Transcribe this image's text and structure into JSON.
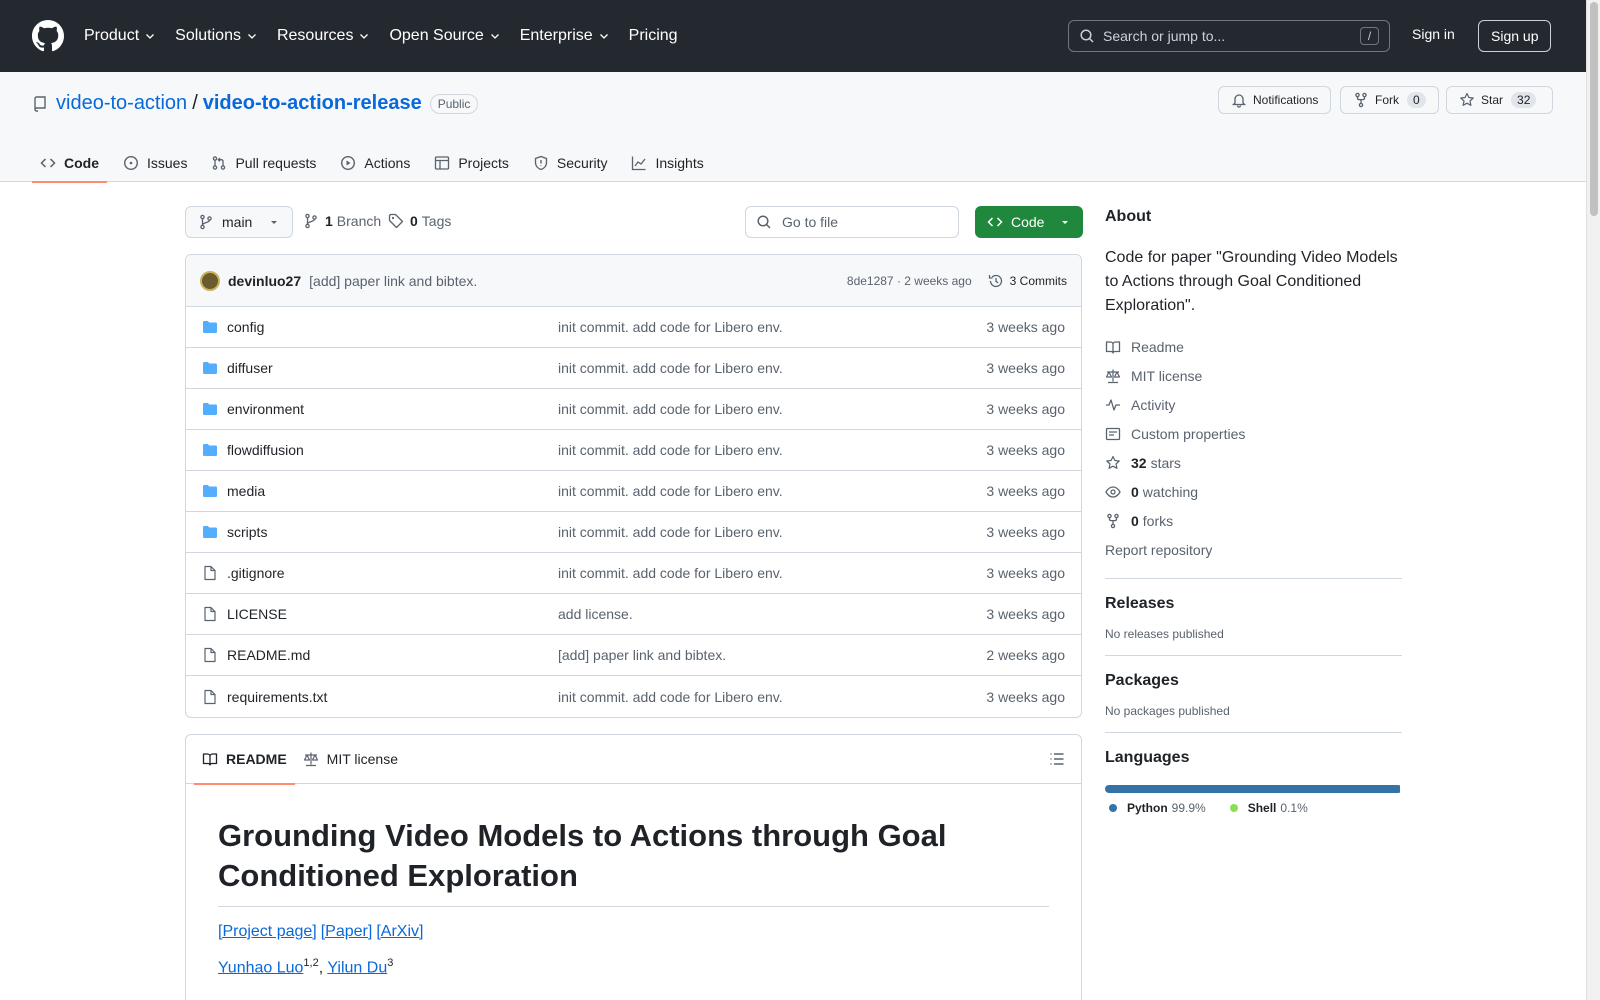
{
  "header": {
    "nav": [
      "Product",
      "Solutions",
      "Resources",
      "Open Source",
      "Enterprise",
      "Pricing"
    ],
    "search_placeholder": "Search or jump to...",
    "search_kbd": "/",
    "sign_in": "Sign in",
    "sign_up": "Sign up"
  },
  "repo": {
    "owner": "video-to-action",
    "name": "video-to-action-release",
    "visibility": "Public",
    "notifications": "Notifications",
    "fork_label": "Fork",
    "fork_count": "0",
    "star_label": "Star",
    "star_count": "32"
  },
  "tabs": [
    "Code",
    "Issues",
    "Pull requests",
    "Actions",
    "Projects",
    "Security",
    "Insights"
  ],
  "toolbar": {
    "branch": "main",
    "branch_count": "1",
    "branch_label": "Branch",
    "tag_count": "0",
    "tag_label": "Tags",
    "go_to_file": "Go to file",
    "code_button": "Code"
  },
  "commit": {
    "author": "devinluo27",
    "message": "[add] paper link and bibtex.",
    "hash_age": "8de1287 · 2 weeks ago",
    "commits": "3 Commits"
  },
  "files": [
    {
      "name": "config",
      "type": "dir",
      "message": "init commit. add code for Libero env.",
      "age": "3 weeks ago"
    },
    {
      "name": "diffuser",
      "type": "dir",
      "message": "init commit. add code for Libero env.",
      "age": "3 weeks ago"
    },
    {
      "name": "environment",
      "type": "dir",
      "message": "init commit. add code for Libero env.",
      "age": "3 weeks ago"
    },
    {
      "name": "flowdiffusion",
      "type": "dir",
      "message": "init commit. add code for Libero env.",
      "age": "3 weeks ago"
    },
    {
      "name": "media",
      "type": "dir",
      "message": "init commit. add code for Libero env.",
      "age": "3 weeks ago"
    },
    {
      "name": "scripts",
      "type": "dir",
      "message": "init commit. add code for Libero env.",
      "age": "3 weeks ago"
    },
    {
      "name": ".gitignore",
      "type": "file",
      "message": "init commit. add code for Libero env.",
      "age": "3 weeks ago"
    },
    {
      "name": "LICENSE",
      "type": "file",
      "message": "add license.",
      "age": "3 weeks ago"
    },
    {
      "name": "README.md",
      "type": "file",
      "message": "[add] paper link and bibtex.",
      "age": "2 weeks ago"
    },
    {
      "name": "requirements.txt",
      "type": "file",
      "message": "init commit. add code for Libero env.",
      "age": "3 weeks ago"
    }
  ],
  "readme": {
    "tab_readme": "README",
    "tab_license": "MIT license",
    "title": "Grounding Video Models to Actions through Goal Conditioned Exploration",
    "links": [
      "[Project page]",
      "[Paper]",
      "[ArXiv]"
    ],
    "author1": "Yunhao Luo",
    "author1_sup": "1,2",
    "separator": ",",
    "author2": "Yilun Du",
    "author2_sup": "3"
  },
  "about": {
    "heading": "About",
    "description": "Code for paper \"Grounding Video Models to Actions through Goal Conditioned Exploration\".",
    "readme": "Readme",
    "license": "MIT license",
    "activity": "Activity",
    "custom_properties": "Custom properties",
    "stars_count": "32",
    "stars_label": "stars",
    "watching_count": "0",
    "watching_label": "watching",
    "forks_count": "0",
    "forks_label": "forks",
    "report": "Report repository"
  },
  "releases": {
    "heading": "Releases",
    "text": "No releases published"
  },
  "packages": {
    "heading": "Packages",
    "text": "No packages published"
  },
  "languages": {
    "heading": "Languages",
    "items": [
      {
        "name": "Python",
        "pct": "99.9%",
        "value": 99.9,
        "color": "#3572A5"
      },
      {
        "name": "Shell",
        "pct": "0.1%",
        "value": 0.1,
        "color": "#89e051"
      }
    ]
  }
}
